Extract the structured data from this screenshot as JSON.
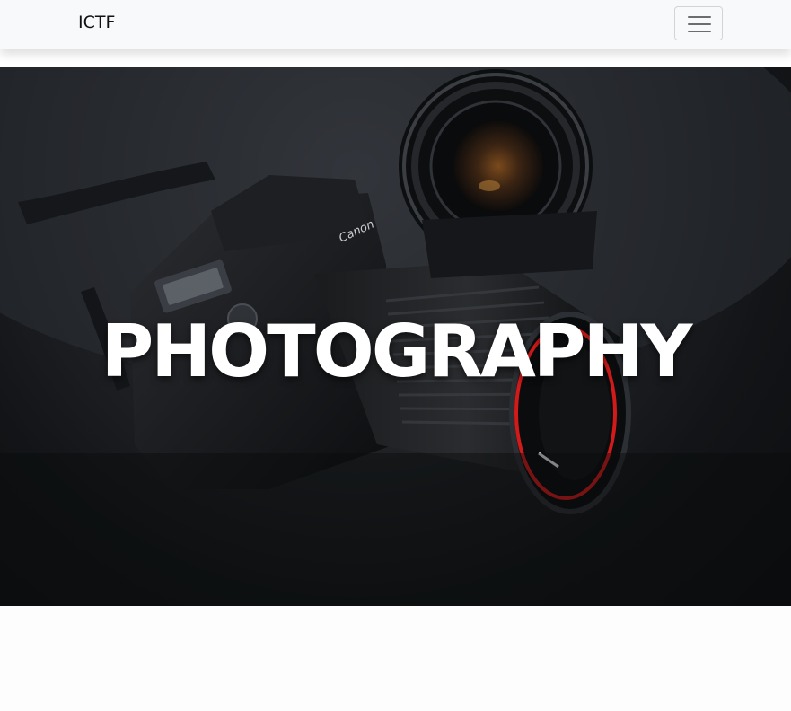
{
  "navbar": {
    "brand": "ICTF",
    "toggler_icon": "hamburger-menu-icon"
  },
  "hero": {
    "title": "PHOTOGRAPHY",
    "background_image": "camera-with-lens-photo",
    "camera_brand_text": "Canon"
  },
  "colors": {
    "navbar_bg": "#f8f9fa",
    "hero_title": "#ffffff",
    "lens_ring_accent": "#d11a1a"
  }
}
